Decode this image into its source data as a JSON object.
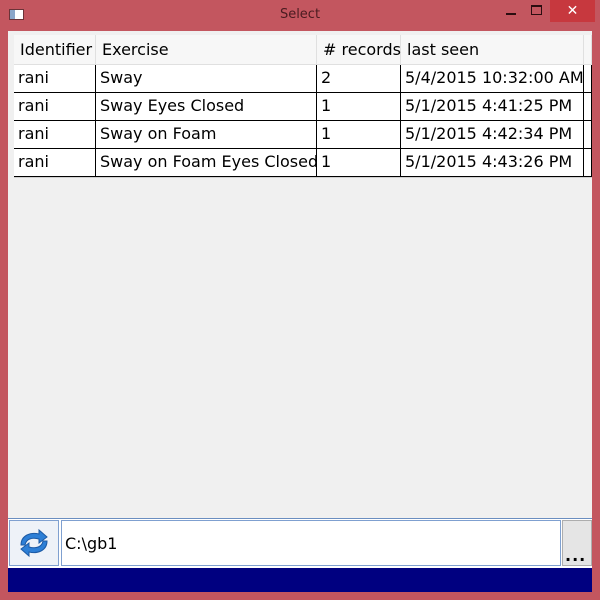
{
  "window": {
    "title": "Select",
    "close_glyph": "✕"
  },
  "table": {
    "columns": [
      "Identifier",
      "Exercise",
      "# records",
      "last seen"
    ],
    "rows": [
      [
        "rani",
        "Sway",
        "2",
        "5/4/2015 10:32:00 AM"
      ],
      [
        "rani",
        "Sway Eyes Closed",
        "1",
        "5/1/2015 4:41:25 PM"
      ],
      [
        "rani",
        "Sway on Foam",
        "1",
        "5/1/2015 4:42:34 PM"
      ],
      [
        "rani",
        "Sway on Foam Eyes Closed",
        "1",
        "5/1/2015 4:43:26 PM"
      ]
    ]
  },
  "path": {
    "value": "C:\\gb1"
  },
  "browse": {
    "label": "..."
  },
  "icons": {
    "refresh": "refresh-icon",
    "app": "app-window-icon"
  },
  "colors": {
    "frame": "#c3565f",
    "status_bar": "#000080",
    "close_button": "#c7383e"
  }
}
